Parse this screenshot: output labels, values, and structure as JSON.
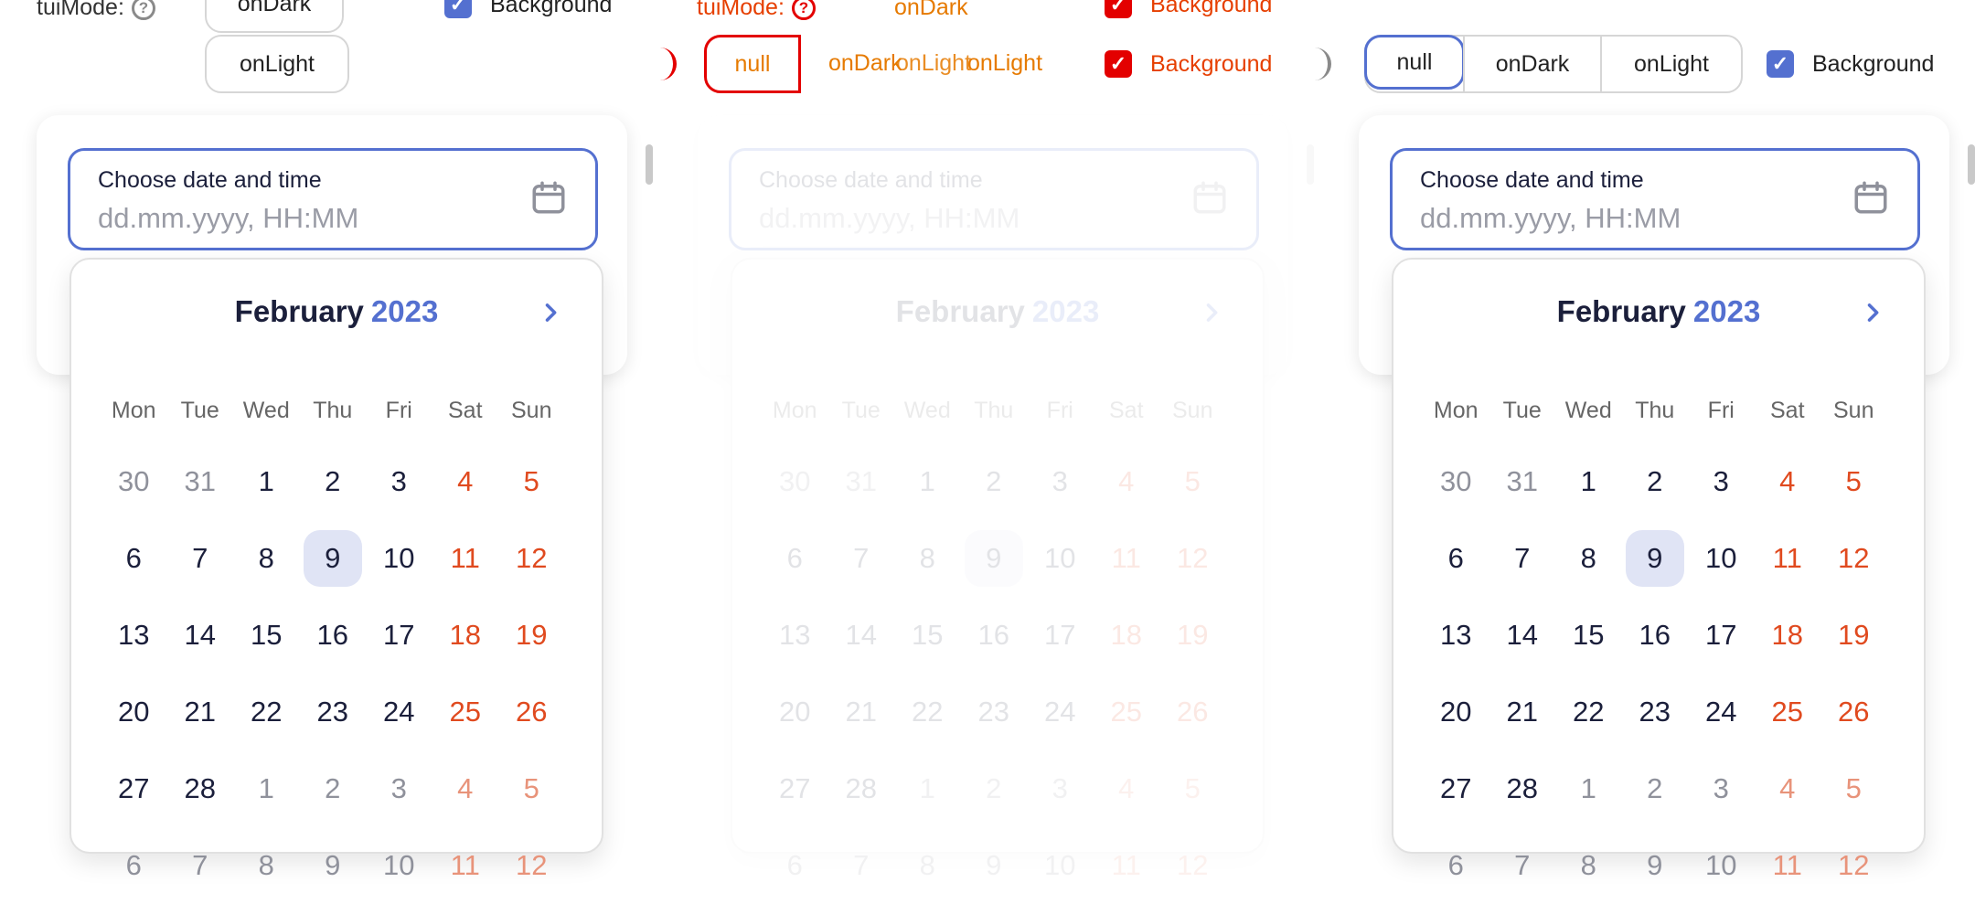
{
  "controls": {
    "mode_label": "tuiMode:",
    "mode_options": [
      "null",
      "onDark",
      "onLight"
    ],
    "background_label": "Background",
    "background_checked": true,
    "accent": "#5470d0",
    "overlay_color": "#e30000"
  },
  "datepicker": {
    "field_label": "Choose date and time",
    "field_placeholder": "dd.mm.yyyy, HH:MM",
    "month": "February",
    "year": "2023",
    "weekdays": [
      "Mon",
      "Tue",
      "Wed",
      "Thu",
      "Fri",
      "Sat",
      "Sun"
    ],
    "weeks": [
      [
        "30",
        "31",
        "1",
        "2",
        "3",
        "4",
        "5"
      ],
      [
        "6",
        "7",
        "8",
        "9",
        "10",
        "11",
        "12"
      ],
      [
        "13",
        "14",
        "15",
        "16",
        "17",
        "18",
        "19"
      ],
      [
        "20",
        "21",
        "22",
        "23",
        "24",
        "25",
        "26"
      ],
      [
        "27",
        "28",
        "1",
        "2",
        "3",
        "4",
        "5"
      ],
      [
        "6",
        "7",
        "8",
        "9",
        "10",
        "11",
        "12"
      ]
    ],
    "selected_day": "9",
    "icons": {
      "calendar": "calendar-icon",
      "next": "chevron-right-icon"
    }
  }
}
